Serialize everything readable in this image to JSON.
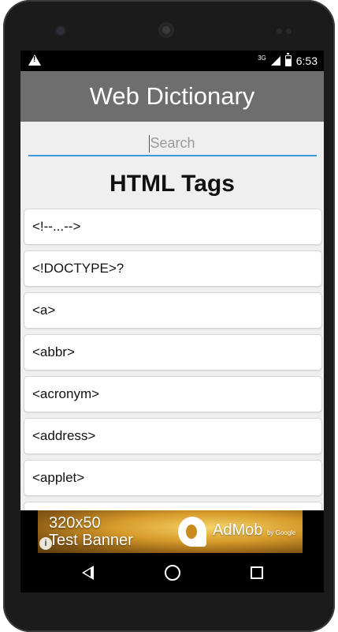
{
  "status_bar": {
    "network": "3G",
    "time": "6:53"
  },
  "app": {
    "title": "Web Dictionary"
  },
  "search": {
    "placeholder": "Search"
  },
  "main": {
    "heading": "HTML Tags",
    "items": [
      "<!--...-->",
      "<!DOCTYPE>?",
      "<a>",
      "<abbr>",
      "<acronym>",
      "<address>",
      "<applet>",
      ""
    ]
  },
  "ad": {
    "line1": "320x50",
    "line2": "Test Banner",
    "brand": "AdMob",
    "brand_sub": "by Google",
    "info_icon": "info-icon"
  },
  "navigation": {
    "back": "back-icon",
    "home": "home-icon",
    "recent": "recent-apps-icon"
  }
}
